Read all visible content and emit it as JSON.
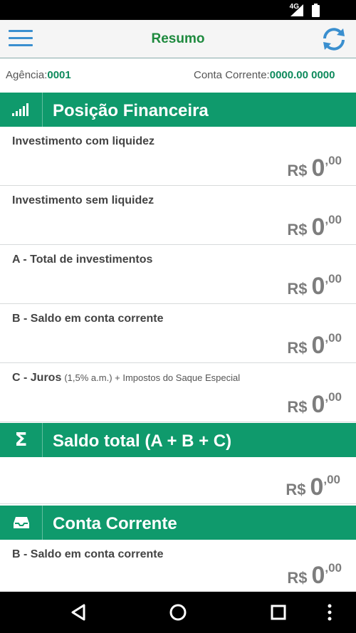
{
  "status_bar": {
    "network": "4G",
    "signal_icon": "signal-icon",
    "battery_icon": "battery-icon"
  },
  "app_bar": {
    "title": "Resumo",
    "menu_icon": "hamburger-menu-icon",
    "refresh_icon": "refresh-icon"
  },
  "account": {
    "agency_label": "Agência:",
    "agency_value": "0001",
    "conta_label": "Conta Corrente:",
    "conta_value": "0000.00 0000"
  },
  "sections": {
    "posicao": {
      "title": "Posição Financeira",
      "icon": "signal-bars-icon"
    },
    "saldo_total": {
      "title": "Saldo total (A + B + C)",
      "icon": "sigma-icon"
    },
    "conta_corrente": {
      "title": "Conta Corrente",
      "icon": "inbox-tray-icon"
    }
  },
  "items": [
    {
      "label": "Investimento com liquidez",
      "currency": "R$",
      "int": "0",
      "dec": ",00"
    },
    {
      "label": "Investimento sem liquidez",
      "currency": "R$",
      "int": "0",
      "dec": ",00"
    },
    {
      "label": "A - Total de investimentos",
      "currency": "R$",
      "int": "0",
      "dec": ",00"
    },
    {
      "label": "B - Saldo em conta corrente",
      "currency": "R$",
      "int": "0",
      "dec": ",00"
    },
    {
      "label": "C - Juros",
      "note": "(1,5% a.m.) + Impostos do Saque Especial",
      "currency": "R$",
      "int": "0",
      "dec": ",00"
    }
  ],
  "saldo_total": {
    "currency": "R$",
    "int": "0",
    "dec": ",00"
  },
  "conta_corrente_item": {
    "label": "B - Saldo em conta corrente",
    "currency": "R$",
    "int": "0",
    "dec": ",00"
  },
  "nav": {
    "back_icon": "back-triangle-icon",
    "home_icon": "home-circle-icon",
    "recents_icon": "recents-square-icon",
    "more_icon": "more-vertical-icon"
  },
  "colors": {
    "accent_green": "#0f9a6c",
    "title_green": "#1e8a3e",
    "icon_blue": "#3a8fcf",
    "amount_gray": "#7d7d7d"
  }
}
